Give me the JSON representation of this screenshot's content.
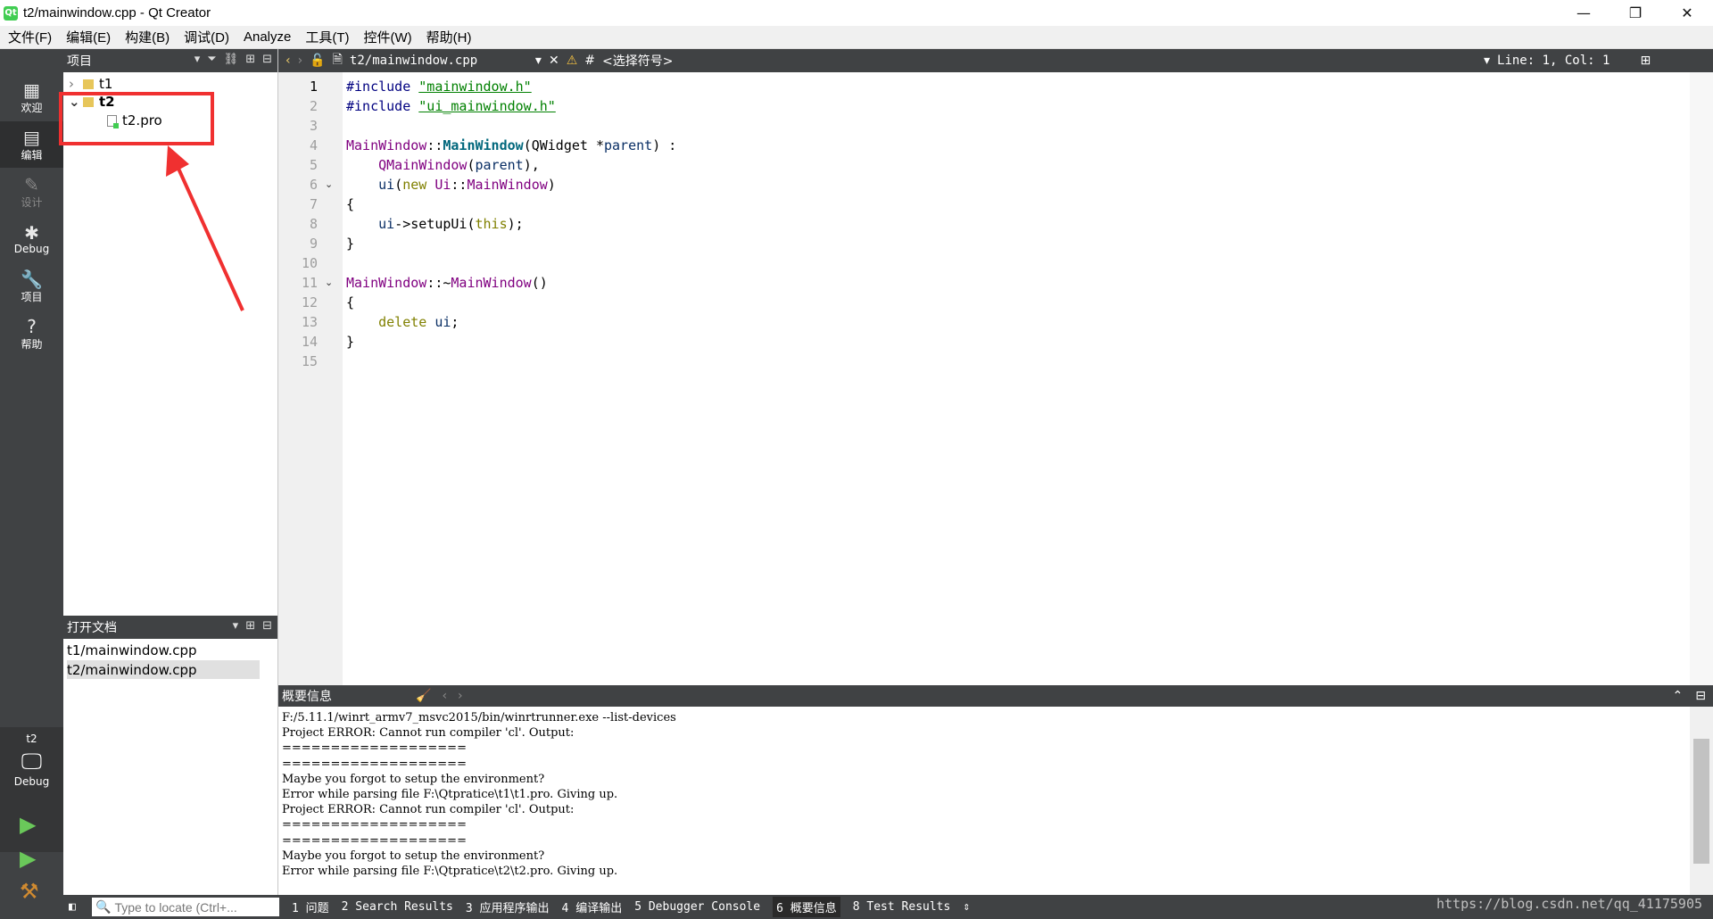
{
  "window": {
    "title": "t2/mainwindow.cpp - Qt Creator",
    "minimize": "—",
    "restore": "❐",
    "close": "✕"
  },
  "menu": [
    "文件(F)",
    "编辑(E)",
    "构建(B)",
    "调试(D)",
    "Analyze",
    "工具(T)",
    "控件(W)",
    "帮助(H)"
  ],
  "modes": [
    {
      "label": "欢迎",
      "icon": "grid-icon"
    },
    {
      "label": "编辑",
      "icon": "edit-icon"
    },
    {
      "label": "设计",
      "icon": "pencil-icon"
    },
    {
      "label": "Debug",
      "icon": "bug-icon"
    },
    {
      "label": "项目",
      "icon": "wrench-icon"
    },
    {
      "label": "帮助",
      "icon": "help-icon"
    }
  ],
  "kit": {
    "project": "t2",
    "label": "Debug"
  },
  "projects_pane": {
    "title": "项目",
    "items": [
      {
        "name": "t1",
        "expanded": false
      },
      {
        "name": "t2",
        "expanded": true
      },
      {
        "name": "t2.pro",
        "child": true
      }
    ]
  },
  "open_docs": {
    "title": "打开文档",
    "files": [
      "t1/mainwindow.cpp",
      "t2/mainwindow.cpp"
    ],
    "selected": 1
  },
  "editor": {
    "file": "t2/mainwindow.cpp",
    "symbol": "<选择符号>",
    "position": "Line: 1, Col: 1",
    "hash": "#"
  },
  "code_lines": [
    "1",
    "2",
    "3",
    "4",
    "5",
    "6",
    "7",
    "8",
    "9",
    "10",
    "11",
    "12",
    "13",
    "14",
    "15"
  ],
  "output": {
    "title": "概要信息",
    "lines": [
      "F:/5.11.1/winrt_armv7_msvc2015/bin/winrtrunner.exe --list-devices",
      "Project ERROR: Cannot run compiler 'cl'. Output:",
      "===================",
      "===================",
      "Maybe you forgot to setup the environment?",
      "Error while parsing file F:\\Qtpratice\\t1\\t1.pro. Giving up.",
      "Project ERROR: Cannot run compiler 'cl'. Output:",
      "===================",
      "===================",
      "Maybe you forgot to setup the environment?",
      "Error while parsing file F:\\Qtpratice\\t2\\t2.pro. Giving up."
    ]
  },
  "status": {
    "locator_placeholder": "Type to locate (Ctrl+...",
    "tabs": [
      "1 问题",
      "2 Search Results",
      "3 应用程序输出",
      "4 编译输出",
      "5 Debugger Console",
      "6 概要信息",
      "8 Test Results"
    ],
    "selected_tab": 5
  },
  "watermark": "https://blog.csdn.net/qq_41175905"
}
